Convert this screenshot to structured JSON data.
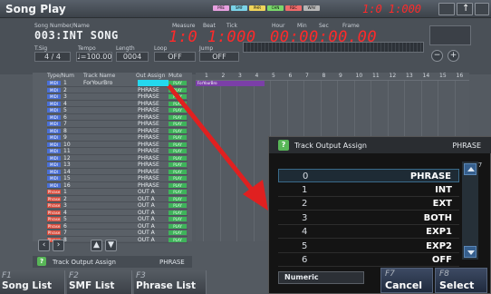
{
  "window": {
    "title": "Song Play",
    "position": "1:0 1:000",
    "status_badges": [
      "PRE",
      "SMF",
      "PHR",
      "CHN",
      "REC",
      "WAV"
    ]
  },
  "info": {
    "labels": {
      "song_number_name": "Song Number/Name",
      "measure": "Measure",
      "beat": "Beat",
      "tick": "Tick",
      "hour": "Hour",
      "min": "Min",
      "sec": "Sec",
      "frame": "Frame",
      "tsig": "T.Sig",
      "tempo": "Tempo",
      "length": "Length",
      "loop": "Loop",
      "jump": "Jump"
    },
    "song_name": "003:INT SONG",
    "time_sig": "4 / 4",
    "tempo": "♩=100.00",
    "length": "0004",
    "loop": "OFF",
    "jump": "OFF",
    "measure_beat_tick": "1:0 1:000",
    "time_code": "00:00:00.00"
  },
  "tracklist": {
    "headers": {
      "type_num": "Type/Num",
      "track_name": "Track Name",
      "out_assign": "Out Assign",
      "mute": "Mute"
    },
    "rows": [
      {
        "type": "MIDI",
        "num": "1",
        "name": "ForYourBro",
        "assign": "PHRASE",
        "mute": "PLAY"
      },
      {
        "type": "MIDI",
        "num": "2",
        "name": "",
        "assign": "PHRASE",
        "mute": "PLAY"
      },
      {
        "type": "MIDI",
        "num": "3",
        "name": "",
        "assign": "PHRASE",
        "mute": "PLAY"
      },
      {
        "type": "MIDI",
        "num": "4",
        "name": "",
        "assign": "PHRASE",
        "mute": "PLAY"
      },
      {
        "type": "MIDI",
        "num": "5",
        "name": "",
        "assign": "PHRASE",
        "mute": "PLAY"
      },
      {
        "type": "MIDI",
        "num": "6",
        "name": "",
        "assign": "PHRASE",
        "mute": "PLAY"
      },
      {
        "type": "MIDI",
        "num": "7",
        "name": "",
        "assign": "PHRASE",
        "mute": "PLAY"
      },
      {
        "type": "MIDI",
        "num": "8",
        "name": "",
        "assign": "PHRASE",
        "mute": "PLAY"
      },
      {
        "type": "MIDI",
        "num": "9",
        "name": "",
        "assign": "PHRASE",
        "mute": "PLAY"
      },
      {
        "type": "MIDI",
        "num": "10",
        "name": "",
        "assign": "PHRASE",
        "mute": "PLAY"
      },
      {
        "type": "MIDI",
        "num": "11",
        "name": "",
        "assign": "PHRASE",
        "mute": "PLAY"
      },
      {
        "type": "MIDI",
        "num": "12",
        "name": "",
        "assign": "PHRASE",
        "mute": "PLAY"
      },
      {
        "type": "MIDI",
        "num": "13",
        "name": "",
        "assign": "PHRASE",
        "mute": "PLAY"
      },
      {
        "type": "MIDI",
        "num": "14",
        "name": "",
        "assign": "PHRASE",
        "mute": "PLAY"
      },
      {
        "type": "MIDI",
        "num": "15",
        "name": "",
        "assign": "PHRASE",
        "mute": "PLAY"
      },
      {
        "type": "MIDI",
        "num": "16",
        "name": "",
        "assign": "PHRASE",
        "mute": "PLAY"
      },
      {
        "type": "Phrase",
        "num": "1",
        "name": "",
        "assign": "OUT A",
        "mute": "PLAY"
      },
      {
        "type": "Phrase",
        "num": "2",
        "name": "",
        "assign": "OUT A",
        "mute": "PLAY"
      },
      {
        "type": "Phrase",
        "num": "3",
        "name": "",
        "assign": "OUT A",
        "mute": "PLAY"
      },
      {
        "type": "Phrase",
        "num": "4",
        "name": "",
        "assign": "OUT A",
        "mute": "PLAY"
      },
      {
        "type": "Phrase",
        "num": "5",
        "name": "",
        "assign": "OUT A",
        "mute": "PLAY"
      },
      {
        "type": "Phrase",
        "num": "6",
        "name": "",
        "assign": "OUT A",
        "mute": "PLAY"
      },
      {
        "type": "Phrase",
        "num": "7",
        "name": "",
        "assign": "OUT A",
        "mute": "PLAY"
      },
      {
        "type": "Phrase",
        "num": "8",
        "name": "",
        "assign": "OUT A",
        "mute": "PLAY"
      }
    ]
  },
  "grid": {
    "columns": [
      "1",
      "2",
      "3",
      "4",
      "5",
      "6",
      "7",
      "8",
      "9",
      "10",
      "11",
      "12",
      "13",
      "14",
      "15",
      "16"
    ],
    "clip_label": "ForYourBro"
  },
  "status": {
    "text": "Track Output Assign",
    "value": "PHRASE"
  },
  "fkeys": [
    {
      "fn": "F1",
      "label": "Song List"
    },
    {
      "fn": "F2",
      "label": "SMF List"
    },
    {
      "fn": "F3",
      "label": "Phrase List"
    }
  ],
  "popup": {
    "title": "Track Output Assign",
    "value": "PHRASE",
    "page": "1/7",
    "options": [
      {
        "num": "0",
        "label": "PHRASE"
      },
      {
        "num": "1",
        "label": "INT"
      },
      {
        "num": "2",
        "label": "EXT"
      },
      {
        "num": "3",
        "label": "BOTH"
      },
      {
        "num": "4",
        "label": "EXP1"
      },
      {
        "num": "5",
        "label": "EXP2"
      },
      {
        "num": "6",
        "label": "OFF"
      }
    ],
    "numeric": "Numeric",
    "cancel": {
      "fn": "F7",
      "label": "Cancel"
    },
    "select": {
      "fn": "F8",
      "label": "Select"
    }
  },
  "colors": {
    "accent_red": "#ff2a2a",
    "selection_cyan": "#24d8ee",
    "mute_green": "#3fb35b",
    "midi_blue": "#4a6fd6",
    "phrase_red": "#d84a3a"
  }
}
